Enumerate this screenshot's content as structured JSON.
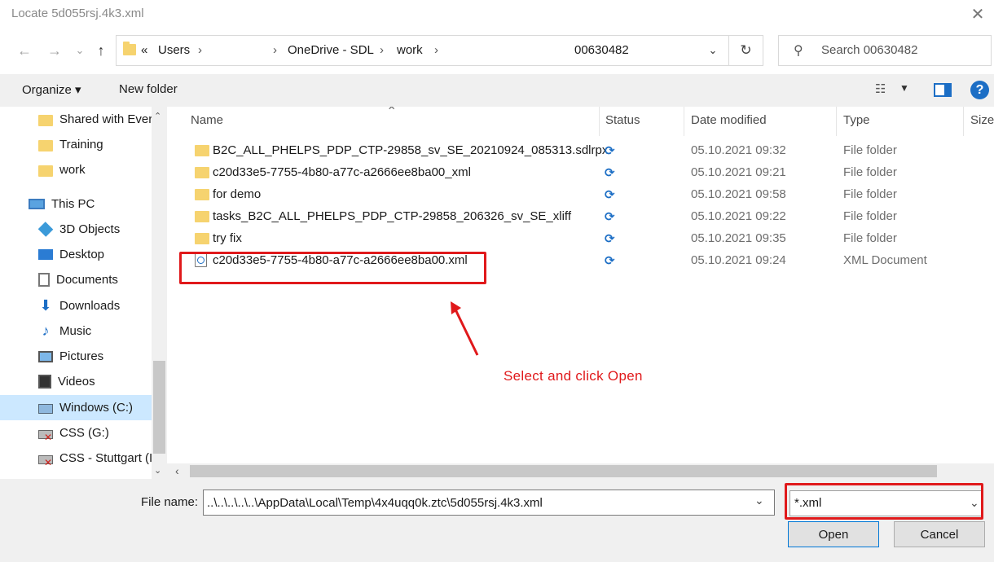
{
  "window": {
    "title": "Locate 5d055rsj.4k3.xml",
    "close_glyph": "✕"
  },
  "nav": {
    "back_glyph": "←",
    "forward_glyph": "→",
    "recent_glyph": "⌄",
    "up_glyph": "↑",
    "breadcrumb": {
      "overflow": "«",
      "items": [
        "Users",
        "OneDrive - SDL",
        "work",
        "00630482"
      ],
      "sep": "›"
    },
    "dropdown_glyph": "⌄",
    "refresh_glyph": "↻",
    "search_placeholder": "Search 00630482"
  },
  "toolbar": {
    "organize_label": "Organize ▾",
    "new_folder_label": "New folder",
    "view_glyph": "☷",
    "view_dd_glyph": "▼",
    "help_glyph": "?"
  },
  "sidebar": {
    "items": [
      {
        "label": "Shared with Ever",
        "icon": "folder-icon"
      },
      {
        "label": "Training",
        "icon": "folder-icon"
      },
      {
        "label": "work",
        "icon": "folder-icon"
      },
      {
        "label": "This PC",
        "icon": "this-pc-icon"
      },
      {
        "label": "3D Objects",
        "icon": "3d-objects-icon"
      },
      {
        "label": "Desktop",
        "icon": "desktop-icon"
      },
      {
        "label": "Documents",
        "icon": "documents-icon"
      },
      {
        "label": "Downloads",
        "icon": "downloads-icon"
      },
      {
        "label": "Music",
        "icon": "music-icon"
      },
      {
        "label": "Pictures",
        "icon": "pictures-icon"
      },
      {
        "label": "Videos",
        "icon": "videos-icon"
      },
      {
        "label": "Windows (C:)",
        "icon": "drive-icon",
        "selected": true
      },
      {
        "label": "CSS (G:)",
        "icon": "network-drive-icon"
      },
      {
        "label": "CSS - Stuttgart (I",
        "icon": "network-drive-icon"
      }
    ],
    "scroll_up": "⌃",
    "scroll_down": "⌄"
  },
  "filelist": {
    "columns": [
      "Name",
      "Status",
      "Date modified",
      "Type",
      "Size"
    ],
    "sort_glyph": "⌃",
    "status_glyph": "⟳",
    "rows": [
      {
        "name": "B2C_ALL_PHELPS_PDP_CTP-29858_sv_SE_20210924_085313.sdlrpx",
        "date": "05.10.2021 09:32",
        "type": "File folder",
        "kind": "folder"
      },
      {
        "name": "c20d33e5-7755-4b80-a77c-a2666ee8ba00_xml",
        "date": "05.10.2021 09:21",
        "type": "File folder",
        "kind": "folder"
      },
      {
        "name": "for demo",
        "date": "05.10.2021 09:58",
        "type": "File folder",
        "kind": "folder"
      },
      {
        "name": "tasks_B2C_ALL_PHELPS_PDP_CTP-29858_206326_sv_SE_xliff",
        "date": "05.10.2021 09:22",
        "type": "File folder",
        "kind": "folder"
      },
      {
        "name": "try fix",
        "date": "05.10.2021 09:35",
        "type": "File folder",
        "kind": "folder"
      },
      {
        "name": "c20d33e5-7755-4b80-a77c-a2666ee8ba00.xml",
        "date": "05.10.2021 09:24",
        "type": "XML Document",
        "kind": "xml"
      }
    ],
    "hscroll_left": "‹"
  },
  "bottom": {
    "file_name_label": "File name:",
    "file_name_value": "..\\..\\..\\..\\..\\AppData\\Local\\Temp\\4x4uqq0k.ztc\\5d055rsj.4k3.xml",
    "file_name_dd": "⌄",
    "filter_value": "*.xml",
    "filter_dd": "⌄",
    "open_label": "Open",
    "cancel_label": "Cancel"
  },
  "annotation": {
    "text": "Select and click Open",
    "color": "#e0191b"
  },
  "colors": {
    "accent": "#1c6ec5",
    "folder": "#f6d36f",
    "selected": "#cce8ff",
    "annotation": "#e0191b"
  }
}
